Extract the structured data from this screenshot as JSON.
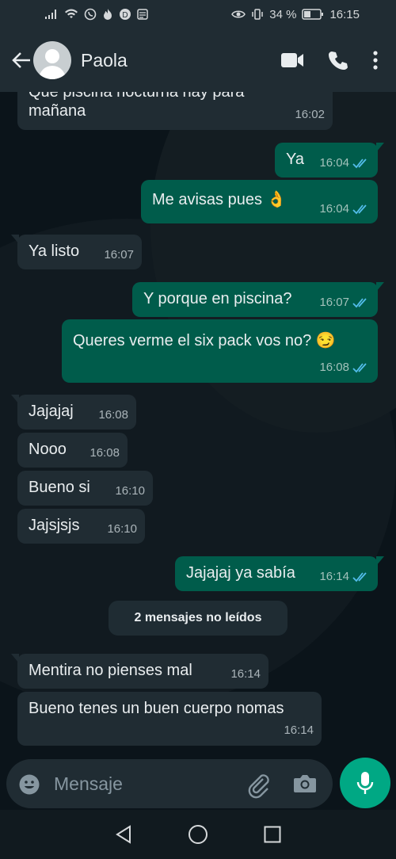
{
  "status_bar": {
    "battery": "34 %",
    "time": "16:15"
  },
  "header": {
    "contact_name": "Paola",
    "icons": [
      "back-arrow-icon",
      "video-call-icon",
      "voice-call-icon",
      "more-options-icon"
    ]
  },
  "messages": [
    {
      "direction": "in",
      "text": "Que piscina nocturna hay para mañana",
      "time": "16:02"
    },
    {
      "direction": "out",
      "text": "Ya",
      "time": "16:04"
    },
    {
      "direction": "out",
      "text": "Me avisas pues 👌",
      "time": "16:04"
    },
    {
      "direction": "in",
      "text": "Ya listo",
      "time": "16:07"
    },
    {
      "direction": "out",
      "text": "Y porque en piscina?",
      "time": "16:07"
    },
    {
      "direction": "out",
      "text": "Queres verme el six pack vos no? 😏",
      "time": "16:08"
    },
    {
      "direction": "in",
      "text": "Jajajaj",
      "time": "16:08"
    },
    {
      "direction": "in",
      "text": "Nooo",
      "time": "16:08"
    },
    {
      "direction": "in",
      "text": "Bueno si",
      "time": "16:10"
    },
    {
      "direction": "in",
      "text": "Jajsjsjs",
      "time": "16:10"
    },
    {
      "direction": "out",
      "text": "Jajajaj ya sabía",
      "time": "16:14"
    },
    {
      "direction": "in",
      "text": "Mentira no pienses mal",
      "time": "16:14"
    },
    {
      "direction": "in",
      "text": "Bueno tenes un buen cuerpo nomas",
      "time": "16:14"
    }
  ],
  "unread_divider": "2 mensajes no leídos",
  "composer": {
    "placeholder": "Mensaje"
  },
  "colors": {
    "incoming": "#202c33",
    "outgoing": "#005c4b",
    "accent": "#00a884",
    "read_checks": "#53bdeb"
  }
}
